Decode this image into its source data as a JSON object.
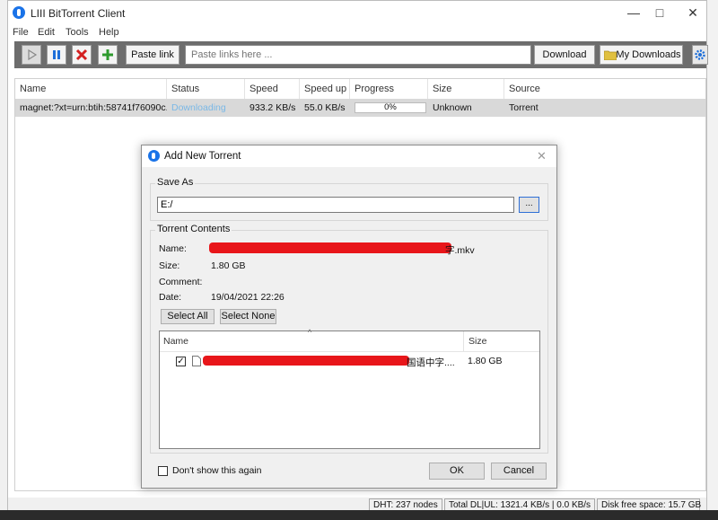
{
  "window": {
    "title": "LIII BitTorrent Client"
  },
  "menu": [
    "File",
    "Edit",
    "Tools",
    "Help"
  ],
  "toolbar": {
    "paste_link_label": "Paste link",
    "link_placeholder": "Paste links here ...",
    "download_label": "Download",
    "my_downloads_label": "My Downloads"
  },
  "table": {
    "columns": [
      "Name",
      "Status",
      "Speed down",
      "Speed up",
      "Progress",
      "Size",
      "Source"
    ],
    "rows": [
      {
        "name": "magnet:?xt=urn:btih:58741f76090c...",
        "status": "Downloading",
        "speed_down": "933.2 KB/s",
        "speed_up": "55.0 KB/s",
        "progress": "0%",
        "progress_value": 0,
        "size": "Unknown",
        "source": "Torrent"
      }
    ]
  },
  "statusbar": {
    "dht": "DHT: 237 nodes",
    "total": "Total DL|UL: 1321.4 KB/s | 0.0 KB/s",
    "disk": "Disk free space: 15.7 GB"
  },
  "dialog": {
    "title": "Add New Torrent",
    "save_as_label": "Save As",
    "save_path": "E:/",
    "browse_label": "...",
    "contents_label": "Torrent Contents",
    "name_label": "Name:",
    "name_value_suffix": "字.mkv",
    "size_label": "Size:",
    "size_value": "1.80 GB",
    "comment_label": "Comment:",
    "date_label": "Date:",
    "date_value": "19/04/2021 22:26",
    "select_all": "Select All",
    "select_none": "Select None",
    "file_columns": {
      "name": "Name",
      "size": "Size"
    },
    "files": [
      {
        "name_suffix": "国语中字....",
        "size": "1.80 GB",
        "checked": true
      }
    ],
    "dont_show": "Don't show this again",
    "ok": "OK",
    "cancel": "Cancel"
  },
  "colors": {
    "toolbar_bg": "#6d6d6d",
    "status_downloading": "#7ab8e6",
    "accent_blue": "#1a73e8",
    "redaction": "#e8161a"
  }
}
